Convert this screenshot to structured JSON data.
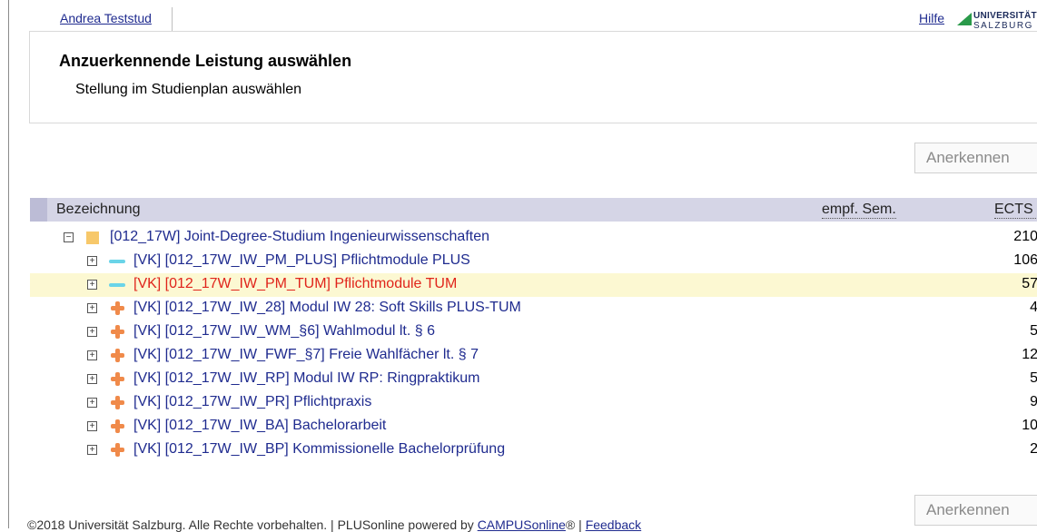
{
  "topbar": {
    "user_name": "Andrea Teststud",
    "help_label": "Hilfe",
    "logo": {
      "line1": "UNIVERSITÄT",
      "line2": "SALZBURG"
    }
  },
  "header": {
    "title": "Anzuerkennende Leistung auswählen",
    "subtitle": "Stellung im Studienplan auswählen"
  },
  "actions": {
    "recognize_label": "Anerkennen"
  },
  "table": {
    "columns": {
      "name": "Bezeichnung",
      "sem": "empf. Sem.",
      "ects": "ECTS Cr"
    },
    "rows": [
      {
        "label": "[012_17W] Joint-Degree-Studium Ingenieurwissenschaften",
        "ects": "210",
        "expander": "−",
        "icon": "folder-icon"
      },
      {
        "label": "[VK] [012_17W_IW_PM_PLUS] Pflichtmodule PLUS",
        "ects": "106",
        "expander": "+",
        "icon": "dash-icon"
      },
      {
        "label": "[VK] [012_17W_IW_PM_TUM] Pflichtmodule TUM",
        "ects": "57",
        "expander": "+",
        "icon": "dash-icon"
      },
      {
        "label": "[VK] [012_17W_IW_28] Modul IW 28: Soft Skills PLUS-TUM",
        "ects": "4",
        "expander": "+",
        "icon": "plus-diamond-icon"
      },
      {
        "label": "[VK] [012_17W_IW_WM_§6] Wahlmodul lt. § 6",
        "ects": "5",
        "expander": "+",
        "icon": "plus-diamond-icon"
      },
      {
        "label": "[VK] [012_17W_IW_FWF_§7] Freie Wahlfächer lt. § 7",
        "ects": "12",
        "expander": "+",
        "icon": "plus-diamond-icon"
      },
      {
        "label": "[VK] [012_17W_IW_RP] Modul IW RP: Ringpraktikum",
        "ects": "5",
        "expander": "+",
        "icon": "plus-diamond-icon"
      },
      {
        "label": "[VK] [012_17W_IW_PR] Pflichtpraxis",
        "ects": "9",
        "expander": "+",
        "icon": "plus-diamond-icon"
      },
      {
        "label": "[VK] [012_17W_IW_BA] Bachelorarbeit",
        "ects": "10",
        "expander": "+",
        "icon": "plus-diamond-icon"
      },
      {
        "label": "[VK] [012_17W_IW_BP] Kommissionelle Bachelorprüfung",
        "ects": "2",
        "expander": "+",
        "icon": "plus-diamond-icon"
      }
    ]
  },
  "footer": {
    "text": "©2018 Universität Salzburg. Alle Rechte vorbehalten. | PLUSonline powered by ",
    "campus_link": "CAMPUSonline",
    "suffix": "® | ",
    "feedback_link": "Feedback"
  },
  "colors": {
    "link": "#1f2b8f",
    "highlight_text": "#e0241b",
    "highlight_bg": "#fcf8d2",
    "table_header": "#d5d5e6"
  }
}
